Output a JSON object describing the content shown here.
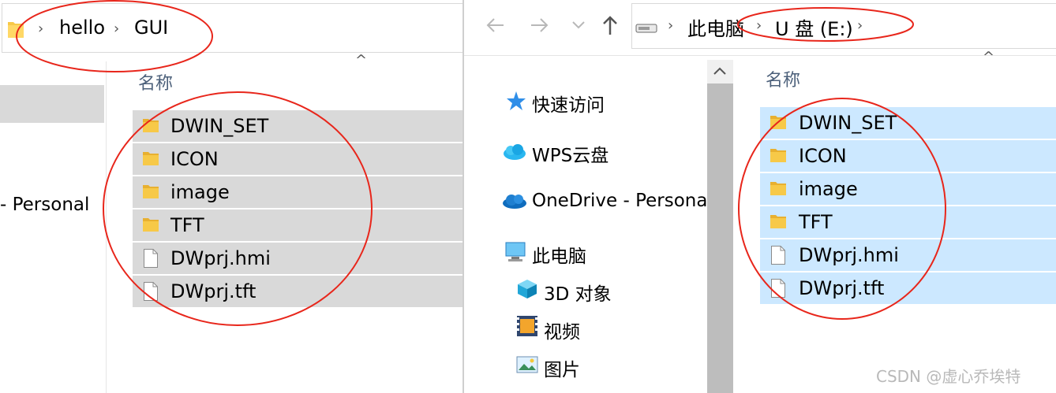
{
  "left_window": {
    "breadcrumb": [
      "hello",
      "GUI"
    ],
    "sidebar_partial_label": "- Personal",
    "column_header": "名称",
    "items": [
      {
        "name": "DWIN_SET",
        "type": "folder"
      },
      {
        "name": "ICON",
        "type": "folder"
      },
      {
        "name": "image",
        "type": "folder"
      },
      {
        "name": "TFT",
        "type": "folder"
      },
      {
        "name": "DWprj.hmi",
        "type": "file"
      },
      {
        "name": "DWprj.tft",
        "type": "file"
      }
    ]
  },
  "right_window": {
    "breadcrumb": [
      "此电脑",
      "U 盘 (E:)"
    ],
    "column_header": "名称",
    "nav": [
      {
        "label": "快速访问",
        "icon": "quick-access-star-icon"
      },
      {
        "label": "WPS云盘",
        "icon": "wps-cloud-icon"
      },
      {
        "label": "OneDrive - Persona",
        "icon": "onedrive-cloud-icon"
      },
      {
        "label": "此电脑",
        "icon": "this-pc-icon"
      },
      {
        "label": "3D 对象",
        "icon": "3d-objects-icon"
      },
      {
        "label": "视频",
        "icon": "videos-icon"
      },
      {
        "label": "图片",
        "icon": "pictures-icon"
      }
    ],
    "items": [
      {
        "name": "DWIN_SET",
        "type": "folder"
      },
      {
        "name": "ICON",
        "type": "folder"
      },
      {
        "name": "image",
        "type": "folder"
      },
      {
        "name": "TFT",
        "type": "folder"
      },
      {
        "name": "DWprj.hmi",
        "type": "file"
      },
      {
        "name": "DWprj.tft",
        "type": "file"
      }
    ]
  },
  "watermark": "CSDN @虚心乔埃特",
  "colors": {
    "left_selection": "#d9d9d9",
    "right_selection": "#cce8ff",
    "folder": "#f7c948",
    "annotation": "#e8261b"
  }
}
